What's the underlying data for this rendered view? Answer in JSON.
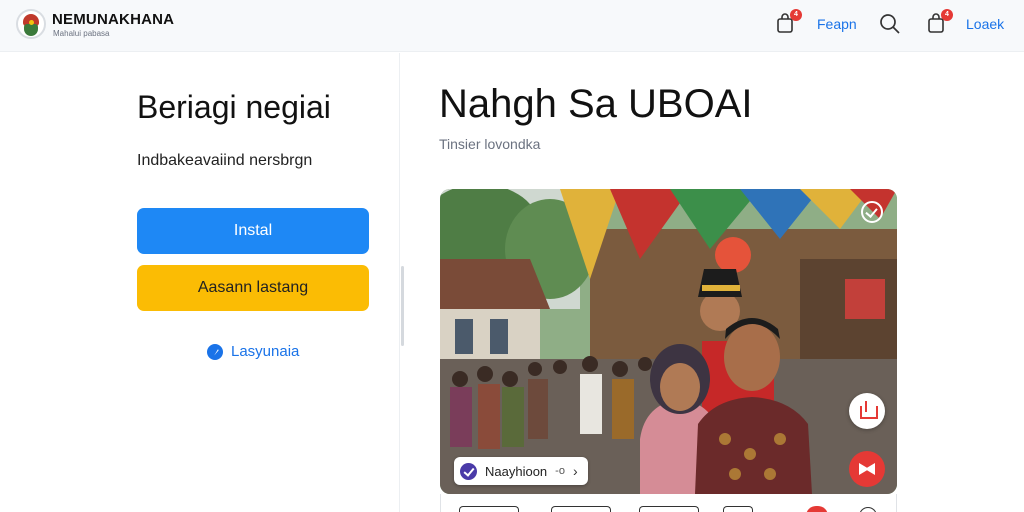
{
  "header": {
    "brand_name": "NEMUNAKHANA",
    "brand_sub": "Mahalui pabasa",
    "cart_badge": "4",
    "link_1": "Feapn",
    "notif_badge": "4",
    "link_2": "Loaek"
  },
  "left": {
    "title": "Beriagi negiai",
    "subtitle": "Indbakeavaiind nersbrgn",
    "install_label": "Instal",
    "alt_label": "Aasann lastang",
    "link_label": "Lasyunaia"
  },
  "right": {
    "title": "Nahgh Sa UBOAI",
    "subtitle": "Tinsier lovondka",
    "tag_label": "Naayhioon",
    "tag_extra": "-o",
    "tag_arrow": "›"
  },
  "colors": {
    "primary": "#1e88f5",
    "secondary": "#fbbc04",
    "accent": "#e53935",
    "link": "#1a73e8"
  }
}
